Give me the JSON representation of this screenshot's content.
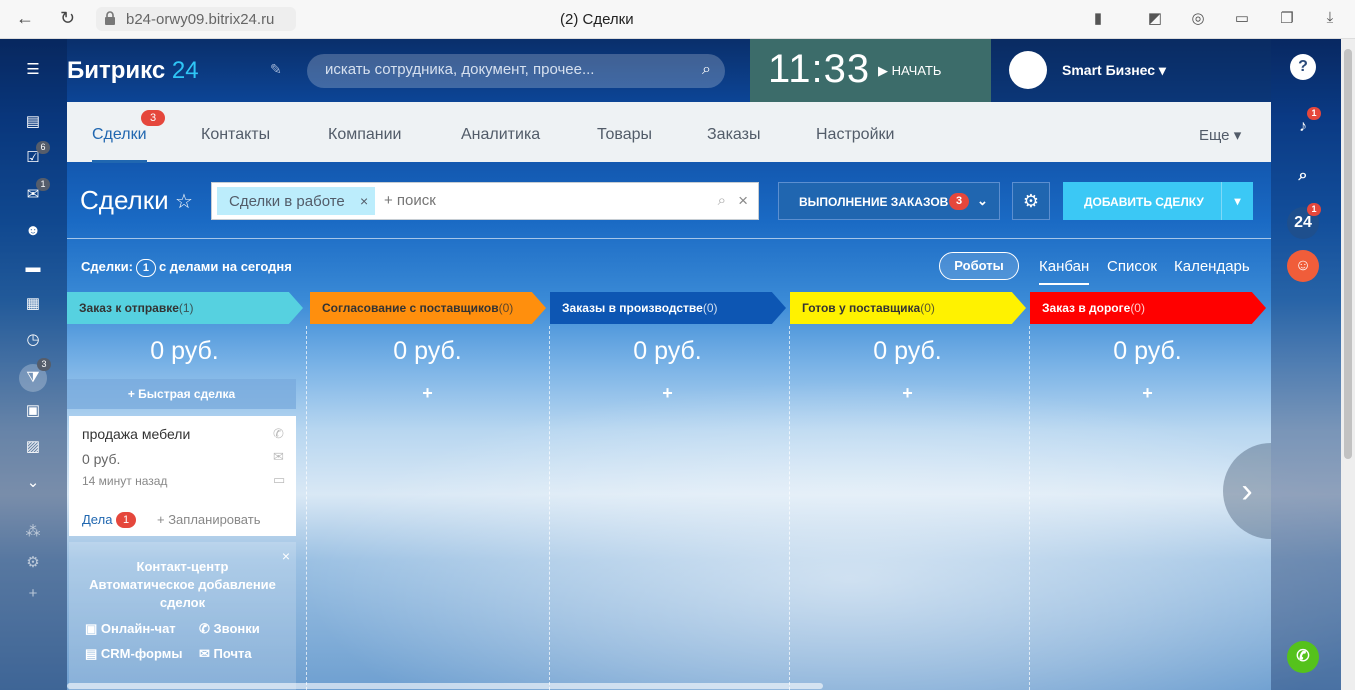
{
  "browser": {
    "url": "b24-orwy09.bitrix24.ru",
    "tab_title": "(2) Сделки"
  },
  "header": {
    "logo_main": "Битрикс",
    "logo_num": "24",
    "search_placeholder": "искать сотрудника, документ, прочее...",
    "time": "11:33",
    "start_label": "НАЧАТЬ",
    "user_name": "Smart Бизнес"
  },
  "left_sidebar": {
    "badges": {
      "tasks": "6",
      "chat": "1",
      "crm": "3"
    }
  },
  "right_sidebar": {
    "notifications_badge": "1",
    "b24_label": "24",
    "b24_badge": "1"
  },
  "tabs": {
    "items": [
      "Сделки",
      "Контакты",
      "Компании",
      "Аналитика",
      "Товары",
      "Заказы",
      "Настройки"
    ],
    "deals_badge": "3",
    "more": "Еще"
  },
  "toolbar": {
    "title": "Сделки",
    "filter_chip": "Сделки в работе",
    "filter_placeholder": "+ поиск",
    "pipeline_label": "ВЫПОЛНЕНИЕ ЗАКАЗОВ",
    "pipeline_badge": "3",
    "add_label": "ДОБАВИТЬ СДЕЛКУ"
  },
  "stats": {
    "prefix": "Сделки:",
    "count": "1",
    "suffix": "с делами на сегодня"
  },
  "views": {
    "robots": "Роботы",
    "kanban": "Канбан",
    "list": "Список",
    "calendar": "Календарь"
  },
  "columns": [
    {
      "title": "Заказ к отправке",
      "count": "(1)",
      "sum": "0 руб.",
      "color": "#56d1e0"
    },
    {
      "title": "Согласование с поставщиков",
      "count": "(0)",
      "sum": "0 руб.",
      "color": "#ff8f0d"
    },
    {
      "title": "Заказы в производстве",
      "count": "(0)",
      "sum": "0 руб.",
      "color": "#0d56b3"
    },
    {
      "title": "Готов у поставщика",
      "count": "(0)",
      "sum": "0 руб.",
      "color": "#fff200"
    },
    {
      "title": "Заказ в дороге",
      "count": "(0)",
      "sum": "0 руб.",
      "color": "#ff0000"
    }
  ],
  "quick_deal": "+ Быстрая сделка",
  "card": {
    "title": "продажа мебели",
    "amount": "0 руб.",
    "time": "14 минут назад",
    "activities_label": "Дела",
    "activities_count": "1",
    "plan_label": "+ Запланировать"
  },
  "promo": {
    "heading": "Контакт-центр\nАвтоматическое добавление сделок",
    "items": [
      "Онлайн-чат",
      "Звонки",
      "CRM-формы",
      "Почта"
    ]
  }
}
